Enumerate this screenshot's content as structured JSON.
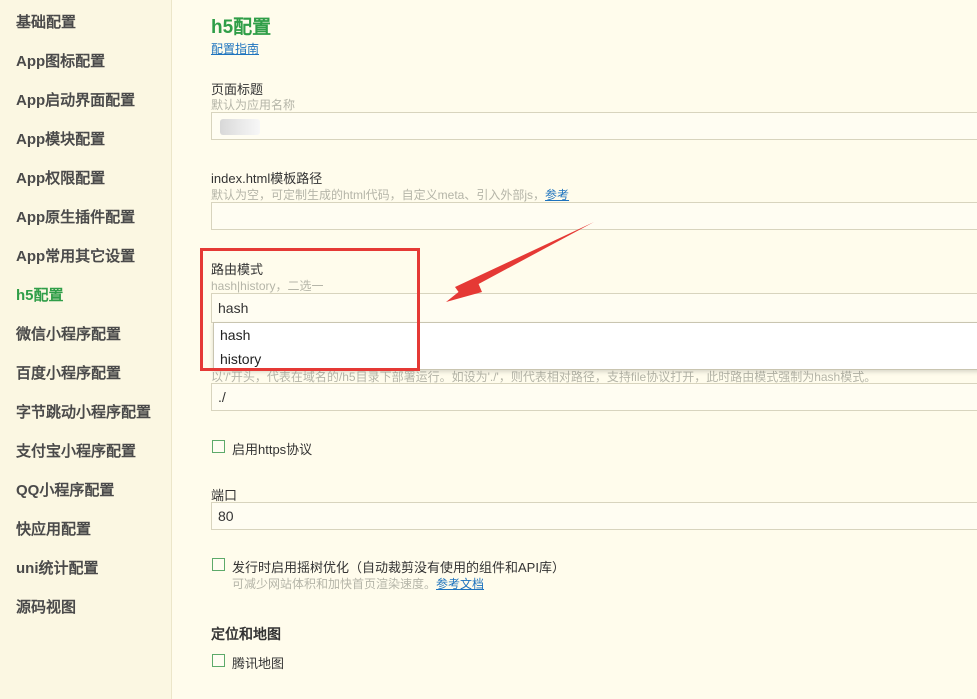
{
  "sidebar": {
    "items": [
      {
        "label": "基础配置"
      },
      {
        "label": "App图标配置"
      },
      {
        "label": "App启动界面配置"
      },
      {
        "label": "App模块配置"
      },
      {
        "label": "App权限配置"
      },
      {
        "label": "App原生插件配置"
      },
      {
        "label": "App常用其它设置"
      },
      {
        "label": "h5配置"
      },
      {
        "label": "微信小程序配置"
      },
      {
        "label": "百度小程序配置"
      },
      {
        "label": "字节跳动小程序配置"
      },
      {
        "label": "支付宝小程序配置"
      },
      {
        "label": "QQ小程序配置"
      },
      {
        "label": "快应用配置"
      },
      {
        "label": "uni统计配置"
      },
      {
        "label": "源码视图"
      }
    ],
    "active_label": "h5配置"
  },
  "main": {
    "title": "h5配置",
    "guide_link": "配置指南",
    "page_title_field": {
      "label": "页面标题",
      "hint": "默认为应用名称"
    },
    "template_field": {
      "label": "index.html模板路径",
      "hint": "默认为空，可定制生成的html代码，自定义meta、引入外部js，",
      "hint_link": "参考",
      "value": ""
    },
    "router_field": {
      "label": "路由模式",
      "hint": "hash|history，二选一",
      "value": "hash",
      "options": [
        "hash",
        "history"
      ]
    },
    "base_field": {
      "hint": "以'/'开头，代表在域名的/h5目录下部署运行。如设为'./'，则代表相对路径，支持file协议打开，此时路由模式强制为hash模式。",
      "value": "./"
    },
    "https_checkbox": {
      "label": "启用https协议",
      "checked": false
    },
    "port_field": {
      "label": "端口",
      "value": "80"
    },
    "treeshake_checkbox": {
      "label": "发行时启用摇树优化（自动裁剪没有使用的组件和API库）",
      "checked": false,
      "hint": "可减少网站体积和加快首页渲染速度。",
      "hint_link": "参考文档"
    },
    "location_section": {
      "title": "定位和地图",
      "tencent_map_checkbox": {
        "label": "腾讯地图",
        "checked": false
      }
    }
  },
  "annotation": {
    "box_color": "#E53935",
    "arrow_color": "#E53935"
  },
  "colors": {
    "background": "#FFFCEC",
    "sidebar_bg": "#FBF7E2",
    "accent_green": "#2F9E48",
    "link_blue": "#1E73BE"
  }
}
